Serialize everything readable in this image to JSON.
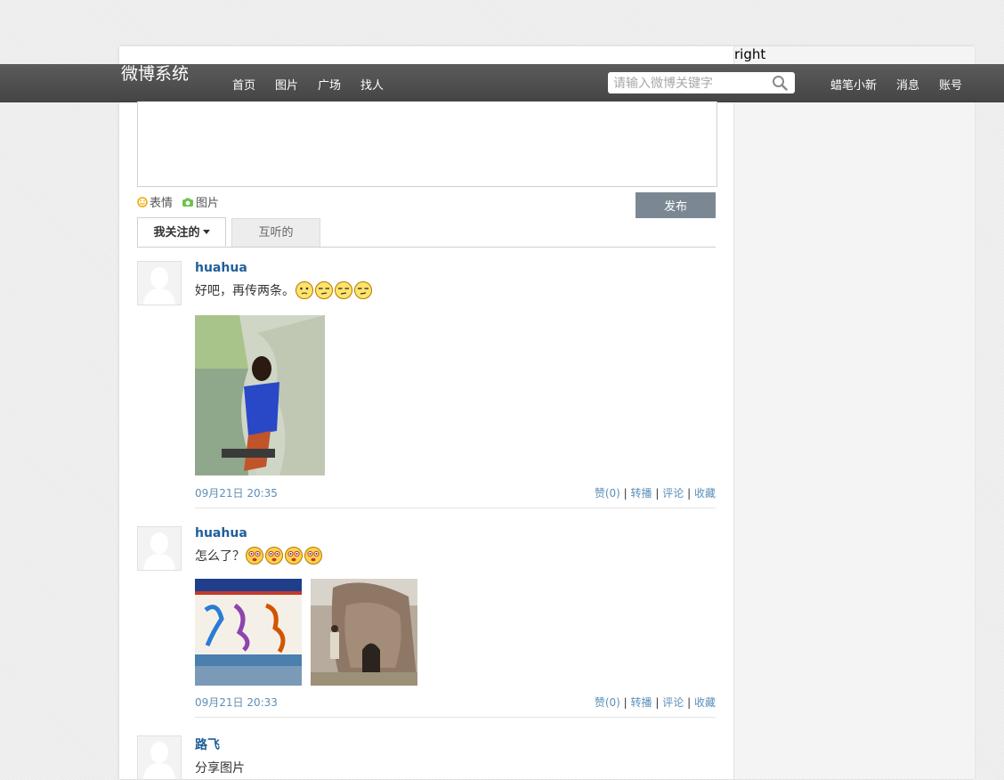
{
  "right_label": "right",
  "header": {
    "brand": "微博系统",
    "nav": [
      "首页",
      "图片",
      "广场",
      "找人"
    ],
    "search_placeholder": "请输入微博关键字",
    "user_nav": [
      "蜡笔小新",
      "消息",
      "账号"
    ]
  },
  "compose": {
    "emoji_label": "表情",
    "image_label": "图片",
    "publish_label": "发布"
  },
  "tabs": {
    "following": "我关注的",
    "mutual": "互听的"
  },
  "actions": {
    "like": "赞(0)",
    "repost": "转播",
    "comment": "评论",
    "favorite": "收藏",
    "separator": "|"
  },
  "posts": [
    {
      "user": "huahua",
      "text": "好吧，再传两条。",
      "time": "09月21日 20:35"
    },
    {
      "user": "huahua",
      "text": "怎么了？",
      "time": "09月21日 20:33"
    },
    {
      "user": "路飞",
      "text": "分享图片"
    }
  ]
}
